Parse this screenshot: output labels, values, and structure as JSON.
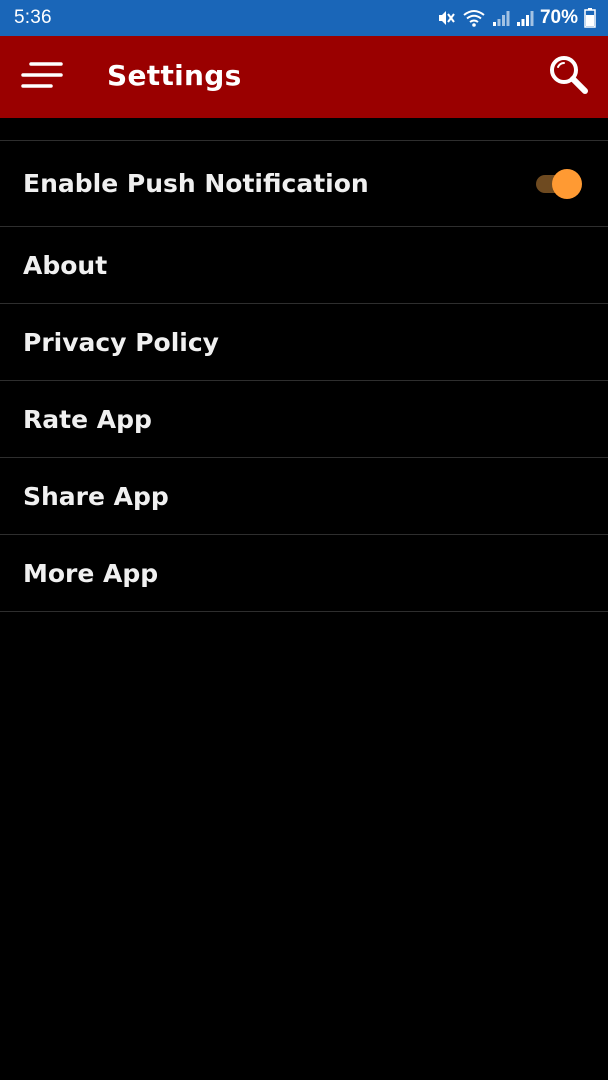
{
  "status_bar": {
    "time": "5:36",
    "battery": "70%",
    "icons": [
      "mute-icon",
      "wifi-icon",
      "signal-icon",
      "signal-icon",
      "battery-icon"
    ]
  },
  "app_bar": {
    "title": "Settings",
    "menu_icon": "hamburger-menu-icon",
    "search_icon": "search-icon",
    "color": "#9a0000"
  },
  "settings": {
    "push_notification": {
      "label": "Enable Push Notification",
      "enabled": true,
      "accent": "#ff9a33"
    },
    "items": [
      {
        "label": "About"
      },
      {
        "label": "Privacy Policy"
      },
      {
        "label": "Rate App"
      },
      {
        "label": "Share App"
      },
      {
        "label": "More App"
      }
    ]
  }
}
